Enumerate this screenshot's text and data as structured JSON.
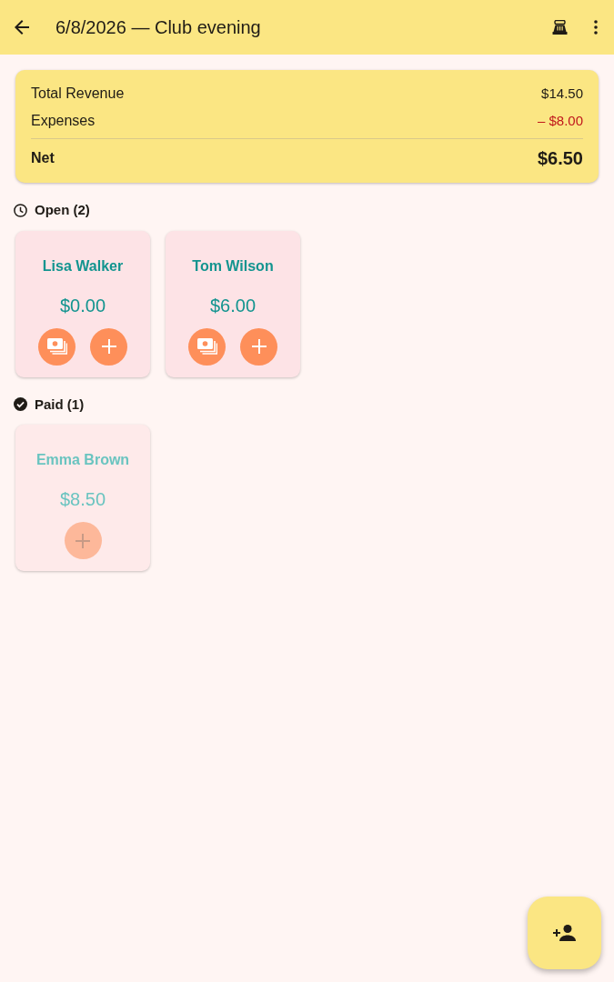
{
  "app_bar": {
    "title": "6/8/2026 — Club evening"
  },
  "summary": {
    "rows": [
      {
        "label": "Total Revenue",
        "value": "$14.50",
        "kind": "plain"
      },
      {
        "label": "Expenses",
        "value": "– $8.00",
        "kind": "expense"
      },
      {
        "label": "Net",
        "value": "$6.50",
        "kind": "total"
      }
    ]
  },
  "sections": [
    {
      "kind": "open",
      "title": "Open (2)",
      "tabs": [
        {
          "name": "Lisa Walker",
          "amount": "$0.00",
          "paid": false
        },
        {
          "name": "Tom Wilson",
          "amount": "$6.00",
          "paid": false
        }
      ]
    },
    {
      "kind": "paid",
      "title": "Paid (1)",
      "tabs": [
        {
          "name": "Emma Brown",
          "amount": "$8.50",
          "paid": true
        }
      ]
    }
  ]
}
